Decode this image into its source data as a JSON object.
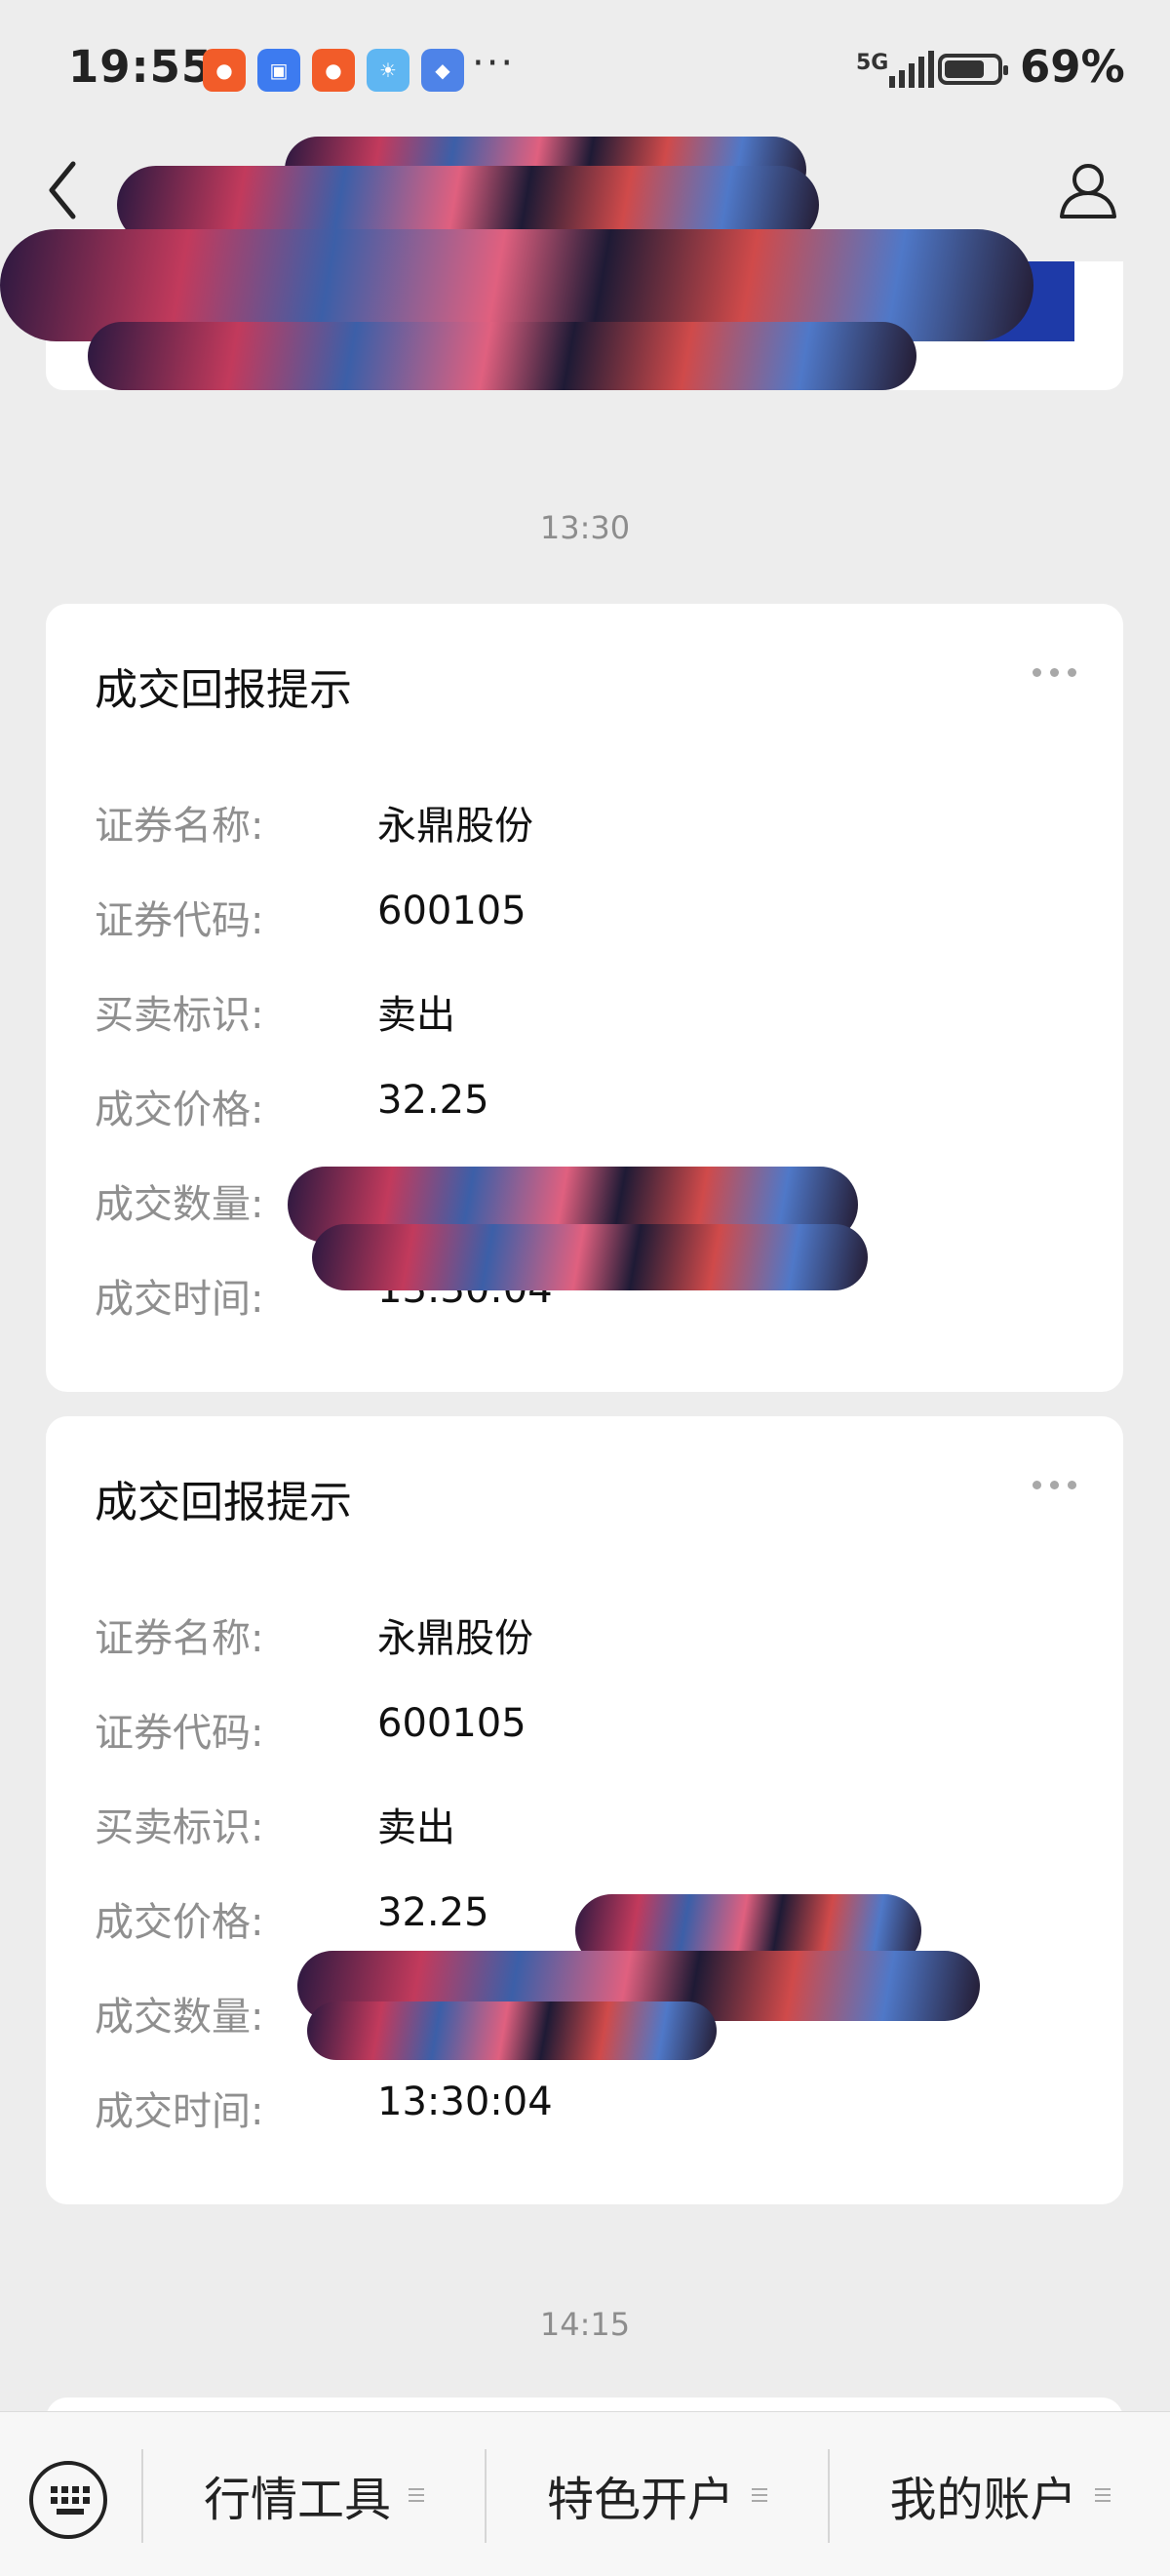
{
  "status_bar": {
    "time": "19:55",
    "network": "5G",
    "battery_percent": "69%",
    "battery_level": 0.69,
    "more_indicator": "···",
    "app_icons": [
      {
        "name": "kuaishou-icon",
        "color": "#f25c29"
      },
      {
        "name": "app-market-icon",
        "color": "#3d7bf0"
      },
      {
        "name": "kuaishou-icon",
        "color": "#f25c29"
      },
      {
        "name": "weather-icon",
        "color": "#5fb6f2"
      },
      {
        "name": "vpn-icon",
        "color": "#4e83e8"
      }
    ]
  },
  "header": {
    "back_icon": "chevron-left-icon",
    "profile_icon": "person-icon"
  },
  "timestamps": {
    "first": "13:30",
    "second": "14:15"
  },
  "cards": [
    {
      "title": "成交回报提示",
      "fields": [
        {
          "label": "证券名称:",
          "value": "永鼎股份"
        },
        {
          "label": "证券代码:",
          "value": "600105"
        },
        {
          "label": "买卖标识:",
          "value": "卖出"
        },
        {
          "label": "成交价格:",
          "value": "32.25"
        },
        {
          "label": "成交数量:",
          "value": ""
        },
        {
          "label": "成交时间:",
          "value": "13:30:04"
        }
      ]
    },
    {
      "title": "成交回报提示",
      "fields": [
        {
          "label": "证券名称:",
          "value": "永鼎股份"
        },
        {
          "label": "证券代码:",
          "value": "600105"
        },
        {
          "label": "买卖标识:",
          "value": "卖出"
        },
        {
          "label": "成交价格:",
          "value": "32.25"
        },
        {
          "label": "成交数量:",
          "value": ""
        },
        {
          "label": "成交时间:",
          "value": "13:30:04"
        }
      ]
    }
  ],
  "bottom_menu": {
    "keyboard_icon": "keyboard-icon",
    "items": [
      {
        "label": "行情工具"
      },
      {
        "label": "特色开户"
      },
      {
        "label": "我的账户"
      }
    ]
  },
  "colors": {
    "background": "#ededed",
    "card": "#ffffff",
    "label_gray": "#8f8f8f",
    "text": "#111111"
  }
}
